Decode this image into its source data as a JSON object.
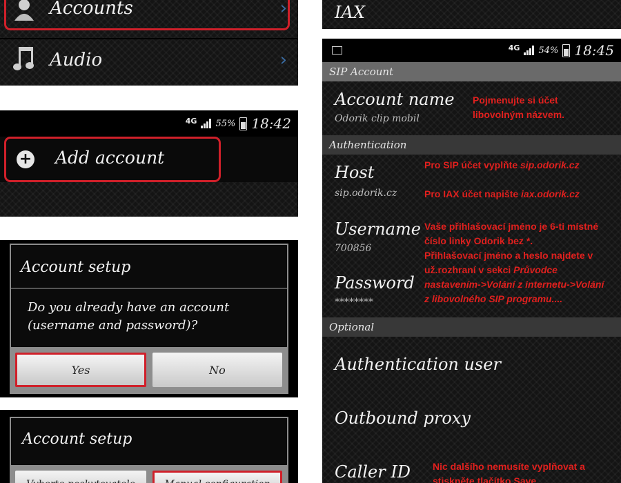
{
  "settings_menu": {
    "items": [
      {
        "label": "Accounts",
        "icon": "contacts-icon"
      },
      {
        "label": "Audio",
        "icon": "music-note-icon"
      }
    ]
  },
  "add_account": {
    "status": {
      "network": "4G",
      "battery": "55%",
      "time": "18:42"
    },
    "label": "Add account"
  },
  "setup_dialog": {
    "title": "Account setup",
    "question": "Do you already have an account (username and password)?",
    "yes": "Yes",
    "no": "No"
  },
  "setup_dialog2": {
    "title": "Account setup",
    "btn_left": "Vyberte poskytovatele",
    "btn_right": "Manual configuration"
  },
  "account_type": {
    "item": "IAX"
  },
  "sip_account": {
    "status": {
      "network": "4G",
      "battery": "54%",
      "time": "18:45"
    },
    "header": "SIP Account",
    "account_name": {
      "label": "Account name",
      "value": "Odorik clip mobil"
    },
    "auth_section": "Authentication",
    "host": {
      "label": "Host",
      "value": "sip.odorik.cz"
    },
    "username": {
      "label": "Username",
      "value": "700856"
    },
    "password": {
      "label": "Password",
      "value": "********"
    },
    "optional_section": "Optional",
    "auth_user": "Authentication user",
    "outbound_proxy": "Outbound proxy",
    "caller_id": "Caller ID"
  },
  "annotations": {
    "account_name_1": "Pojmenujte si účet",
    "account_name_2": "libovolným názvem.",
    "sip_prefix": "Pro SIP účet vyplňte",
    "sip_host": "sip.odorik.cz",
    "iax_prefix": "Pro IAX účet napište",
    "iax_host": "iax.odorik.cz",
    "username_1": "Vaše přihlašovací jméno je 6-ti místné",
    "username_2": "číslo linky Odorik bez *.",
    "username_3": "Přihlašovací jméno a heslo najdete v",
    "username_4a": "už.rozhraní v sekci",
    "username_4b": "Průvodce",
    "username_5": "nastavením->Volání z internetu->Volání",
    "username_6": "z libovolného SIP programu....",
    "caller_id_1": "Nic dalšího nemusíte vyplňovat a",
    "caller_id_2": "stiskněte tlačítko Save."
  }
}
